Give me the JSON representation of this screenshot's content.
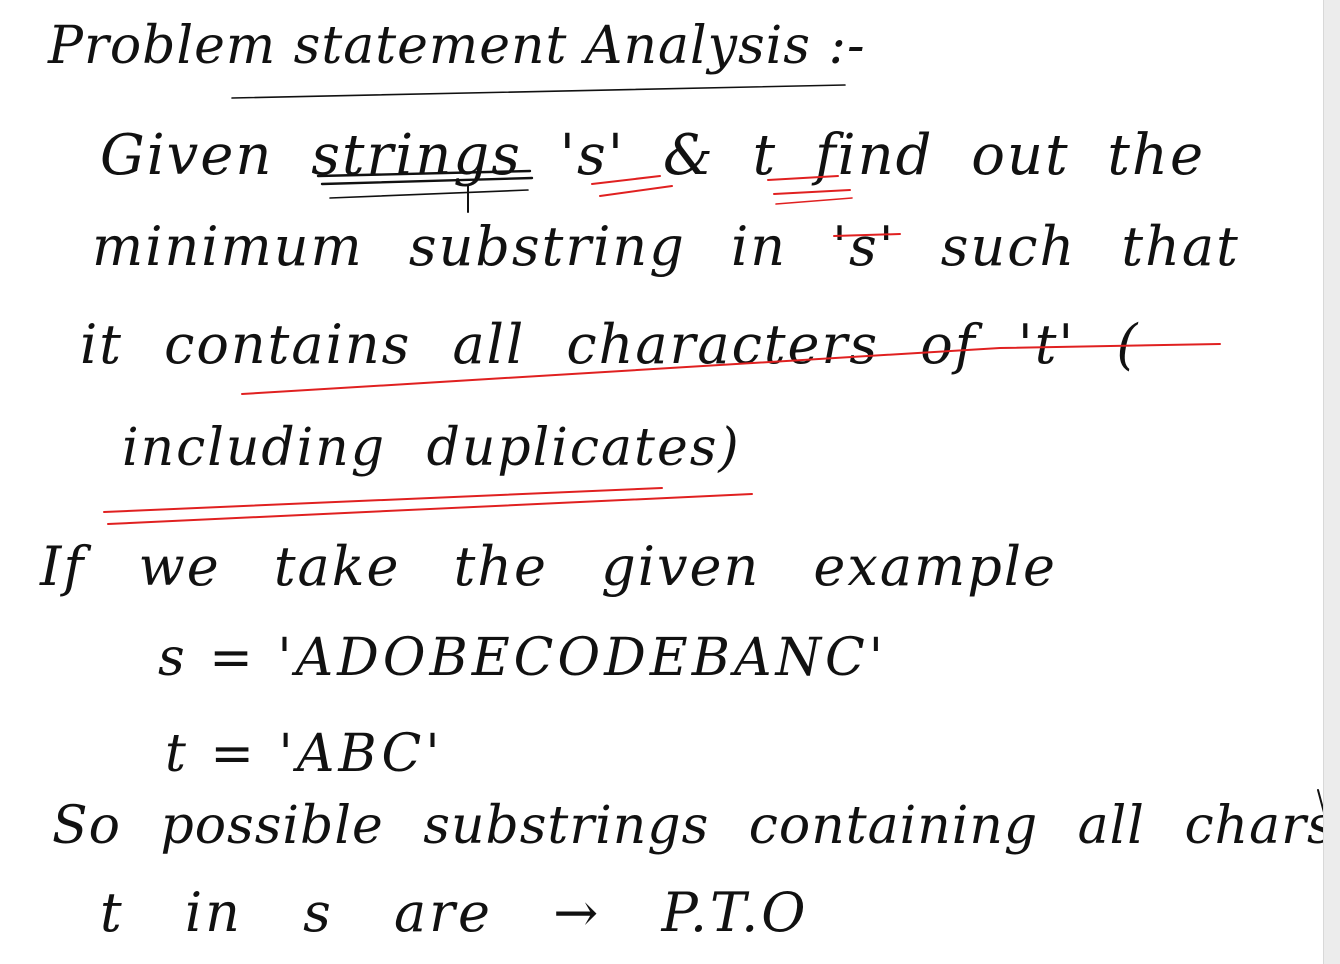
{
  "note": {
    "title": "Problem statement Analysis :-",
    "lines": [
      "Given strings 's' & t find out the",
      "minimum substring in 's' such that",
      "it contains all characters of 't' (",
      "including duplicates)",
      "If we take the given example",
      "s = 'ADOBECODEBANC'",
      "t = 'ABC'",
      "So possible substrings containing all chars of",
      "t in s are → P.T.O"
    ]
  },
  "colors": {
    "ink": "#111111",
    "highlight": "#e02020",
    "paper": "#ffffff"
  }
}
